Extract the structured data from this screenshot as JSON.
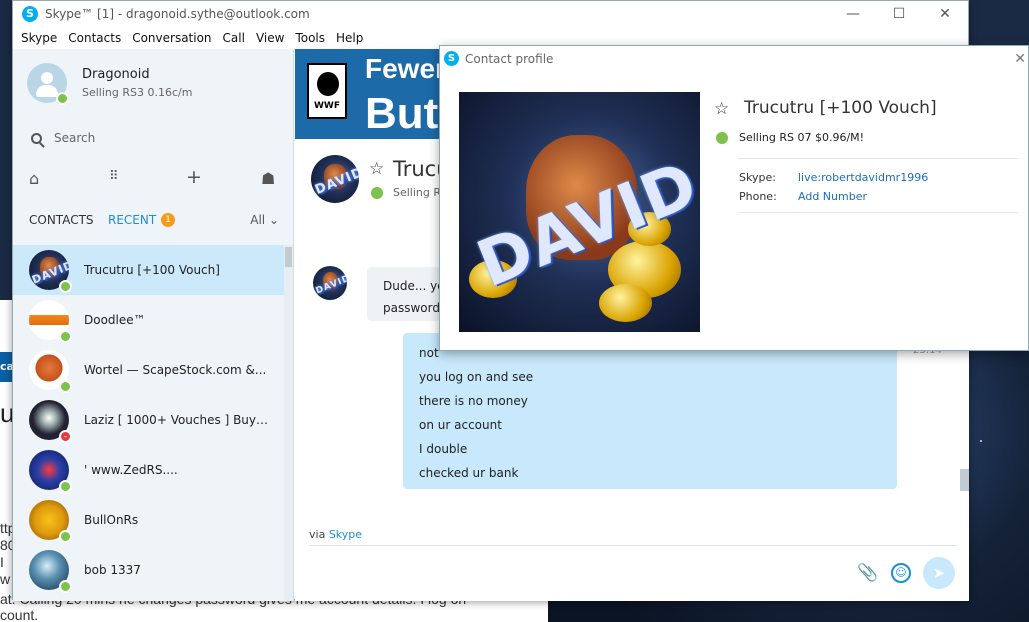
{
  "window": {
    "title": "Skype™ [1] - dragonoid.sythe@outlook.com",
    "logo_letter": "S",
    "controls": {
      "minimize": "—",
      "maximize": "☐",
      "close": "✕"
    }
  },
  "menu": [
    "Skype",
    "Contacts",
    "Conversation",
    "Call",
    "View",
    "Tools",
    "Help"
  ],
  "profile": {
    "name": "Dragonoid",
    "mood": "Selling RS3 0.16c/m",
    "status_color": "#7dc24a"
  },
  "search": {
    "placeholder": "Search"
  },
  "toolbar": {
    "home_icon": "⌂",
    "dialpad_icon": "⠿",
    "add_icon": "+",
    "bot_icon": "☗"
  },
  "tabs": {
    "contacts": "CONTACTS",
    "recent": "RECENT",
    "recent_badge": "1",
    "filter": "All ⌄"
  },
  "contacts": [
    {
      "name": "Trucutru [+100 Vouch]",
      "status": "online",
      "art": "david",
      "selected": true
    },
    {
      "name": "Doodlee™",
      "status": "online",
      "art": "car",
      "selected": false
    },
    {
      "name": "Wortel — ScapeStock.com &...",
      "status": "online",
      "art": "carrot",
      "selected": false
    },
    {
      "name": "Laziz [ 1000+ Vouches ] Buy &...",
      "status": "dnd",
      "art": "dark",
      "selected": false
    },
    {
      "name": "'                         www.ZedRS....",
      "status": "online",
      "art": "zedrs",
      "selected": false
    },
    {
      "name": "BullOnRs",
      "status": "online",
      "art": "bull",
      "selected": false
    },
    {
      "name": "bob 1337",
      "status": "online",
      "art": "globe",
      "selected": false
    }
  ],
  "ad": {
    "line1": "Fewer t",
    "line2": "But V",
    "logo_text": "WWF"
  },
  "conversation": {
    "name": "Trucutru",
    "mood": "Selling R",
    "incoming": [
      "Dude... yo",
      "password"
    ],
    "outgoing": [
      "not",
      "you log on and see",
      "there is no money",
      "on ur account",
      "I double",
      "checked ur bank"
    ],
    "timestamp": "23:14",
    "via_prefix": "via",
    "via_link": "Skype"
  },
  "compose": {
    "attach_icon": "📎",
    "emoji_icon": "☺",
    "send_icon": "➤"
  },
  "contact_profile": {
    "title": "Contact profile",
    "close": "✕",
    "name": "Trucutru [+100 Vouch]",
    "mood": "Selling RS 07 $0.96/M!",
    "skype_label": "Skype:",
    "skype_value": "live:robertdavidmr1996",
    "phone_label": "Phone:",
    "phone_value": "Add Number",
    "avatar_text": "DAVID"
  },
  "background_doc": {
    "lines": [
      "ttp",
      "80",
      "I",
      "w",
      "at. Calling 20 mins he changes password gives me account details. I log on",
      "count."
    ],
    "blue_tab": "ca",
    "big": "ut"
  }
}
